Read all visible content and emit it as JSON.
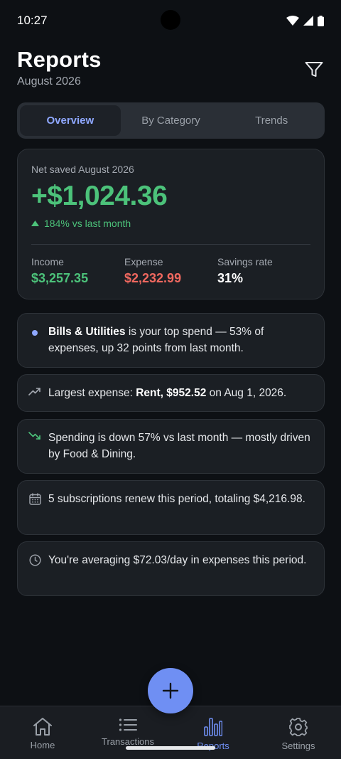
{
  "status": {
    "time": "10:27"
  },
  "header": {
    "title": "Reports",
    "subtitle": "August 2026"
  },
  "tabs": [
    {
      "label": "Overview",
      "active": true
    },
    {
      "label": "By Category",
      "active": false
    },
    {
      "label": "Trends",
      "active": false
    }
  ],
  "summary": {
    "net_label": "Net saved August 2026",
    "net_value": "+$1,024.36",
    "delta": "184% vs last month",
    "stats": [
      {
        "label": "Income",
        "value": "$3,257.35"
      },
      {
        "label": "Expense",
        "value": "$2,232.99"
      },
      {
        "label": "Savings rate",
        "value": "31%"
      }
    ]
  },
  "insights": [
    {
      "icon": "dot-icon",
      "bold": "Bills & Utilities",
      "text": " is your top spend — 53% of expenses, up 32 points from last month."
    },
    {
      "icon": "trending-up-icon",
      "pre": "Largest expense: ",
      "bold": "Rent, $952.52",
      "post": " on Aug 1, 2026."
    },
    {
      "icon": "trending-down-icon",
      "text": "Spending is down 57% vs last month — mostly driven by Food & Dining."
    },
    {
      "icon": "calendar-icon",
      "text": "5 subscriptions renew this period, totaling $4,216.98."
    },
    {
      "icon": "clock-icon",
      "text": "You're averaging $72.03/day in expenses this period."
    }
  ],
  "nav": [
    {
      "label": "Home",
      "icon": "home-icon"
    },
    {
      "label": "Transactions",
      "icon": "list-icon"
    },
    {
      "label": "Reports",
      "icon": "bar-chart-icon",
      "active": true
    },
    {
      "label": "Settings",
      "icon": "gear-icon"
    }
  ],
  "colors": {
    "accent": "#6f8ff3",
    "positive": "#4cc27a",
    "negative": "#f0685f",
    "background": "#0d1014",
    "card": "#1b1f24"
  }
}
